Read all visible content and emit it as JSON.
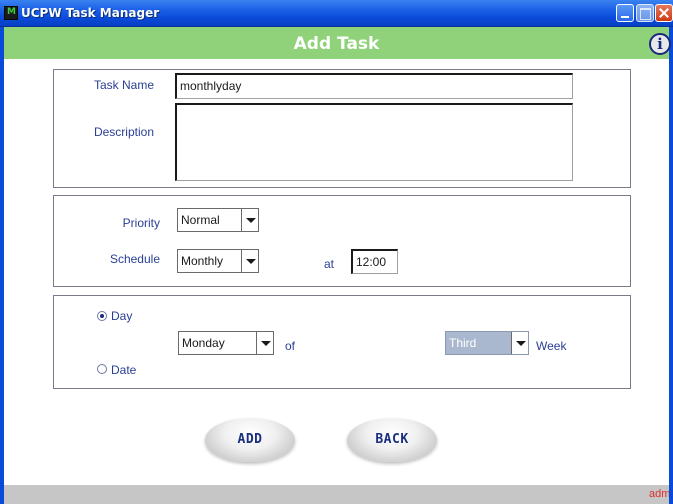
{
  "window": {
    "title": "UCPW Task Manager",
    "controls": [
      "minimize-icon",
      "maximize-icon",
      "close-icon"
    ]
  },
  "header": {
    "title": "Add Task",
    "info_icon": "i",
    "band_color": "#8fd27a"
  },
  "task": {
    "name_label": "Task Name",
    "name_value": "monthlyday",
    "description_label": "Description",
    "description_value": ""
  },
  "schedule": {
    "priority_label": "Priority",
    "priority_value": "Normal",
    "schedule_label": "Schedule",
    "schedule_value": "Monthly",
    "at_label": "at",
    "time_value": "12:00"
  },
  "recurrence": {
    "day_option_label": "Day",
    "date_option_label": "Date",
    "selected_option": "Day",
    "weekday_value": "Monday",
    "of_label": "of",
    "week_value": "Third",
    "week_label": "Week"
  },
  "actions": {
    "add_label": "ADD",
    "back_label": "BACK"
  },
  "status": {
    "user": "admin"
  },
  "colors": {
    "titlebar": "#0a4ad8",
    "label_text": "#2a3f95",
    "status_user": "#e03030"
  }
}
